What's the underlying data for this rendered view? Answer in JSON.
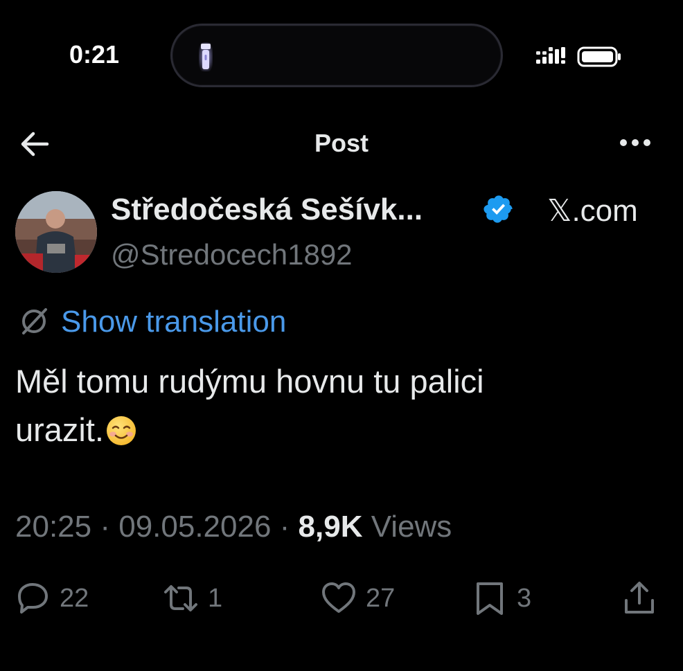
{
  "status_bar": {
    "time": "0:21"
  },
  "header": {
    "title": "Post"
  },
  "author": {
    "display_name": "Středočeská Sešívk...",
    "handle": "@Stredocech1892",
    "verified": true,
    "source": "𝕏.com"
  },
  "translation": {
    "label": "Show translation"
  },
  "post": {
    "text_line1": "Měl tomu rudýmu hovnu tu palici",
    "text_line2": "urazit."
  },
  "meta": {
    "time": "20:25",
    "separator": " · ",
    "date": "09.05.2026",
    "views_count": "8,9K",
    "views_label": "Views"
  },
  "actions": {
    "replies": "22",
    "reposts": "1",
    "likes": "27",
    "bookmarks": "3"
  },
  "colors": {
    "background": "#000000",
    "text": "#e7e9ea",
    "muted": "#71767b",
    "link": "#4a99e9",
    "verified": "#1d9bf0"
  }
}
